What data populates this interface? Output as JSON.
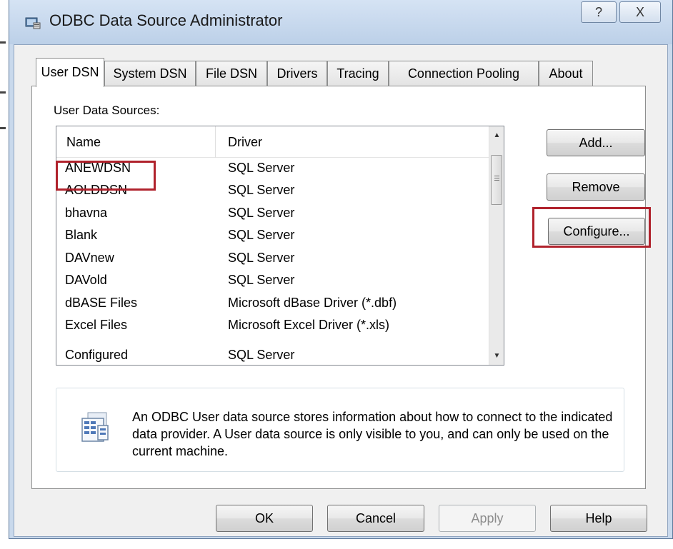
{
  "window": {
    "title": "ODBC Data Source Administrator",
    "help_glyph": "?",
    "close_glyph": "X"
  },
  "tabs": [
    {
      "label": "User DSN",
      "active": true
    },
    {
      "label": "System DSN",
      "active": false
    },
    {
      "label": "File DSN",
      "active": false
    },
    {
      "label": "Drivers",
      "active": false
    },
    {
      "label": "Tracing",
      "active": false
    },
    {
      "label": "Connection Pooling",
      "active": false
    },
    {
      "label": "About",
      "active": false
    }
  ],
  "user_dsn": {
    "section_label": "User Data Sources:",
    "columns": [
      "Name",
      "Driver"
    ],
    "rows": [
      {
        "name": "ANEWDSN",
        "driver": "SQL Server"
      },
      {
        "name": "AOLDDSN",
        "driver": "SQL Server"
      },
      {
        "name": "bhavna",
        "driver": "SQL Server"
      },
      {
        "name": "Blank",
        "driver": "SQL Server"
      },
      {
        "name": "DAVnew",
        "driver": "SQL Server"
      },
      {
        "name": "DAVold",
        "driver": "SQL Server"
      },
      {
        "name": "dBASE Files",
        "driver": "Microsoft dBase Driver (*.dbf)"
      },
      {
        "name": "Excel Files",
        "driver": "Microsoft Excel Driver (*.xls)"
      },
      {
        "name": "Configured",
        "driver": "SQL Server"
      }
    ],
    "buttons": {
      "add": "Add...",
      "remove": "Remove",
      "configure": "Configure..."
    },
    "info_text": "An ODBC User data source stores information about how to connect to the indicated data provider.   A User data source is only visible to you, and can only be used on the current machine."
  },
  "footer": {
    "ok": "OK",
    "cancel": "Cancel",
    "apply": "Apply",
    "help": "Help"
  },
  "colors": {
    "highlight": "#b0222c",
    "titlebar": "#c9d9ec",
    "dialog_bg": "#f0f0f0"
  },
  "icons": [
    "odbc-app-icon",
    "scroll-up-icon",
    "scroll-down-icon",
    "data-source-info-icon"
  ]
}
